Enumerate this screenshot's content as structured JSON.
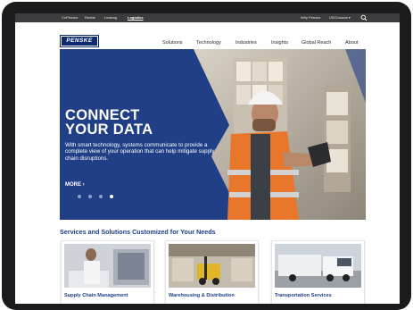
{
  "utility_bar": {
    "links": [
      "CoPenske",
      "Rental",
      "Leasing",
      "Logistics"
    ],
    "active": "Logistics",
    "right_links": [
      "Why Penske",
      "US/Canada ▾"
    ]
  },
  "header": {
    "logo_text": "PENSKE",
    "nav": [
      "Solutions",
      "Technology",
      "Industries",
      "Insights",
      "Global Reach",
      "About"
    ]
  },
  "hero": {
    "title_lines": [
      "CONNECT",
      "YOUR DATA"
    ],
    "subtitle": "With smart technology, systems communicate to provide a complete view of your operation that can help mitigate supply chain disruptions.",
    "cta": "MORE ›",
    "slide_count": 4,
    "active_slide": 4
  },
  "services": {
    "heading": "Services and Solutions Customized for Your Needs",
    "cards": [
      {
        "label": "Supply Chain Management",
        "image": "worker-with-tablet-photo"
      },
      {
        "label": "Warehousing & Distribution",
        "image": "forklift-warehouse-photo"
      },
      {
        "label": "Transportation Services",
        "image": "semi-truck-photo"
      }
    ]
  },
  "colors": {
    "brand_blue": "#1f3e8a",
    "hero_blue": "#203f86",
    "utility_bar": "#3c3c3e",
    "safety_vest": "#e8762b"
  }
}
